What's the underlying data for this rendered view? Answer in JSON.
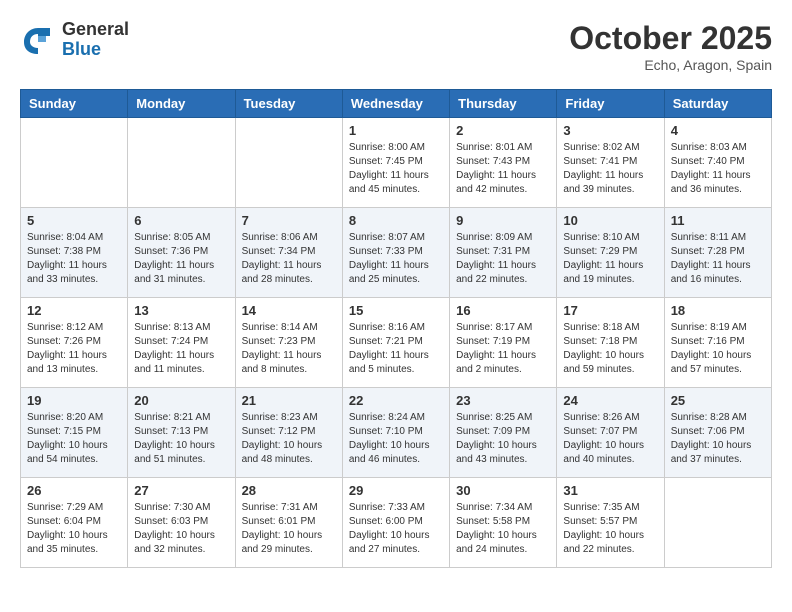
{
  "header": {
    "logo_general": "General",
    "logo_blue": "Blue",
    "month": "October 2025",
    "location": "Echo, Aragon, Spain"
  },
  "weekdays": [
    "Sunday",
    "Monday",
    "Tuesday",
    "Wednesday",
    "Thursday",
    "Friday",
    "Saturday"
  ],
  "weeks": [
    [
      {
        "day": "",
        "sunrise": "",
        "sunset": "",
        "daylight": ""
      },
      {
        "day": "",
        "sunrise": "",
        "sunset": "",
        "daylight": ""
      },
      {
        "day": "",
        "sunrise": "",
        "sunset": "",
        "daylight": ""
      },
      {
        "day": "1",
        "sunrise": "Sunrise: 8:00 AM",
        "sunset": "Sunset: 7:45 PM",
        "daylight": "Daylight: 11 hours and 45 minutes."
      },
      {
        "day": "2",
        "sunrise": "Sunrise: 8:01 AM",
        "sunset": "Sunset: 7:43 PM",
        "daylight": "Daylight: 11 hours and 42 minutes."
      },
      {
        "day": "3",
        "sunrise": "Sunrise: 8:02 AM",
        "sunset": "Sunset: 7:41 PM",
        "daylight": "Daylight: 11 hours and 39 minutes."
      },
      {
        "day": "4",
        "sunrise": "Sunrise: 8:03 AM",
        "sunset": "Sunset: 7:40 PM",
        "daylight": "Daylight: 11 hours and 36 minutes."
      }
    ],
    [
      {
        "day": "5",
        "sunrise": "Sunrise: 8:04 AM",
        "sunset": "Sunset: 7:38 PM",
        "daylight": "Daylight: 11 hours and 33 minutes."
      },
      {
        "day": "6",
        "sunrise": "Sunrise: 8:05 AM",
        "sunset": "Sunset: 7:36 PM",
        "daylight": "Daylight: 11 hours and 31 minutes."
      },
      {
        "day": "7",
        "sunrise": "Sunrise: 8:06 AM",
        "sunset": "Sunset: 7:34 PM",
        "daylight": "Daylight: 11 hours and 28 minutes."
      },
      {
        "day": "8",
        "sunrise": "Sunrise: 8:07 AM",
        "sunset": "Sunset: 7:33 PM",
        "daylight": "Daylight: 11 hours and 25 minutes."
      },
      {
        "day": "9",
        "sunrise": "Sunrise: 8:09 AM",
        "sunset": "Sunset: 7:31 PM",
        "daylight": "Daylight: 11 hours and 22 minutes."
      },
      {
        "day": "10",
        "sunrise": "Sunrise: 8:10 AM",
        "sunset": "Sunset: 7:29 PM",
        "daylight": "Daylight: 11 hours and 19 minutes."
      },
      {
        "day": "11",
        "sunrise": "Sunrise: 8:11 AM",
        "sunset": "Sunset: 7:28 PM",
        "daylight": "Daylight: 11 hours and 16 minutes."
      }
    ],
    [
      {
        "day": "12",
        "sunrise": "Sunrise: 8:12 AM",
        "sunset": "Sunset: 7:26 PM",
        "daylight": "Daylight: 11 hours and 13 minutes."
      },
      {
        "day": "13",
        "sunrise": "Sunrise: 8:13 AM",
        "sunset": "Sunset: 7:24 PM",
        "daylight": "Daylight: 11 hours and 11 minutes."
      },
      {
        "day": "14",
        "sunrise": "Sunrise: 8:14 AM",
        "sunset": "Sunset: 7:23 PM",
        "daylight": "Daylight: 11 hours and 8 minutes."
      },
      {
        "day": "15",
        "sunrise": "Sunrise: 8:16 AM",
        "sunset": "Sunset: 7:21 PM",
        "daylight": "Daylight: 11 hours and 5 minutes."
      },
      {
        "day": "16",
        "sunrise": "Sunrise: 8:17 AM",
        "sunset": "Sunset: 7:19 PM",
        "daylight": "Daylight: 11 hours and 2 minutes."
      },
      {
        "day": "17",
        "sunrise": "Sunrise: 8:18 AM",
        "sunset": "Sunset: 7:18 PM",
        "daylight": "Daylight: 10 hours and 59 minutes."
      },
      {
        "day": "18",
        "sunrise": "Sunrise: 8:19 AM",
        "sunset": "Sunset: 7:16 PM",
        "daylight": "Daylight: 10 hours and 57 minutes."
      }
    ],
    [
      {
        "day": "19",
        "sunrise": "Sunrise: 8:20 AM",
        "sunset": "Sunset: 7:15 PM",
        "daylight": "Daylight: 10 hours and 54 minutes."
      },
      {
        "day": "20",
        "sunrise": "Sunrise: 8:21 AM",
        "sunset": "Sunset: 7:13 PM",
        "daylight": "Daylight: 10 hours and 51 minutes."
      },
      {
        "day": "21",
        "sunrise": "Sunrise: 8:23 AM",
        "sunset": "Sunset: 7:12 PM",
        "daylight": "Daylight: 10 hours and 48 minutes."
      },
      {
        "day": "22",
        "sunrise": "Sunrise: 8:24 AM",
        "sunset": "Sunset: 7:10 PM",
        "daylight": "Daylight: 10 hours and 46 minutes."
      },
      {
        "day": "23",
        "sunrise": "Sunrise: 8:25 AM",
        "sunset": "Sunset: 7:09 PM",
        "daylight": "Daylight: 10 hours and 43 minutes."
      },
      {
        "day": "24",
        "sunrise": "Sunrise: 8:26 AM",
        "sunset": "Sunset: 7:07 PM",
        "daylight": "Daylight: 10 hours and 40 minutes."
      },
      {
        "day": "25",
        "sunrise": "Sunrise: 8:28 AM",
        "sunset": "Sunset: 7:06 PM",
        "daylight": "Daylight: 10 hours and 37 minutes."
      }
    ],
    [
      {
        "day": "26",
        "sunrise": "Sunrise: 7:29 AM",
        "sunset": "Sunset: 6:04 PM",
        "daylight": "Daylight: 10 hours and 35 minutes."
      },
      {
        "day": "27",
        "sunrise": "Sunrise: 7:30 AM",
        "sunset": "Sunset: 6:03 PM",
        "daylight": "Daylight: 10 hours and 32 minutes."
      },
      {
        "day": "28",
        "sunrise": "Sunrise: 7:31 AM",
        "sunset": "Sunset: 6:01 PM",
        "daylight": "Daylight: 10 hours and 29 minutes."
      },
      {
        "day": "29",
        "sunrise": "Sunrise: 7:33 AM",
        "sunset": "Sunset: 6:00 PM",
        "daylight": "Daylight: 10 hours and 27 minutes."
      },
      {
        "day": "30",
        "sunrise": "Sunrise: 7:34 AM",
        "sunset": "Sunset: 5:58 PM",
        "daylight": "Daylight: 10 hours and 24 minutes."
      },
      {
        "day": "31",
        "sunrise": "Sunrise: 7:35 AM",
        "sunset": "Sunset: 5:57 PM",
        "daylight": "Daylight: 10 hours and 22 minutes."
      },
      {
        "day": "",
        "sunrise": "",
        "sunset": "",
        "daylight": ""
      }
    ]
  ]
}
